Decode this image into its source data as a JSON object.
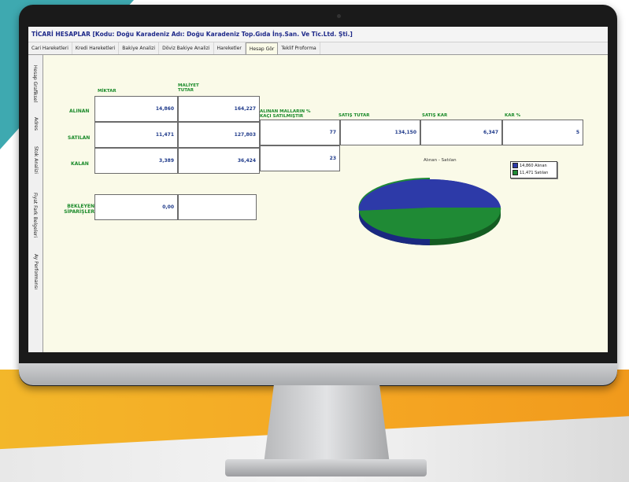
{
  "window": {
    "title": "TİCARİ HESAPLAR [Kodu: Doğu Karadeniz Adı: Doğu Karadeniz Top.Gıda İnş.San. Ve Tic.Ltd. Şti.]"
  },
  "tabs": [
    {
      "label": "Cari Hareketleri"
    },
    {
      "label": "Kredi Hareketleri"
    },
    {
      "label": "Bakiye Analizi"
    },
    {
      "label": "Döviz Bakiye Analizi"
    },
    {
      "label": "Hareketler"
    },
    {
      "label": "Hesap Gör"
    },
    {
      "label": "Teklif Proforma"
    }
  ],
  "active_tab": "Hesap Gör",
  "side_tabs": [
    {
      "label": "Hesap Grafiksel"
    },
    {
      "label": "Adres"
    },
    {
      "label": "Stok Analizi"
    },
    {
      "label": "Fiyat Fark Belgeleri"
    },
    {
      "label": "Ay Performansı"
    }
  ],
  "headers": {
    "miktar": "MİKTAR",
    "maliyet_tutar": "MALİYET TUTAR",
    "alinan_mallarin": "ALINAN MALLARIN % KAÇI SATILMIŞTIR",
    "satis_tutar": "SATIŞ TUTAR",
    "satis_kar": "SATIŞ KAR",
    "kar_yuzde": "KAR %"
  },
  "rows": {
    "alinan": {
      "label": "ALINAN",
      "miktar": "14,860",
      "maliyet": "164,227"
    },
    "satilan": {
      "label": "SATILAN",
      "miktar": "11,471",
      "maliyet": "127,803",
      "yuzde": "77",
      "satis_tutar": "134,150",
      "satis_kar": "6,347",
      "kar_yuzde": "5"
    },
    "kalan": {
      "label": "KALAN",
      "miktar": "3,389",
      "maliyet": "36,424",
      "yuzde": "23"
    }
  },
  "bekleyen": {
    "label": "BEKLEYEN SİPARİŞLER",
    "value": "0,00"
  },
  "pie": {
    "title": "Alınan - Satılan",
    "legend": [
      "14,860 Alınan",
      "11,471 Satılan"
    ],
    "colors": {
      "alinan": "#2d3aa8",
      "satilan": "#1f8a35"
    }
  }
}
